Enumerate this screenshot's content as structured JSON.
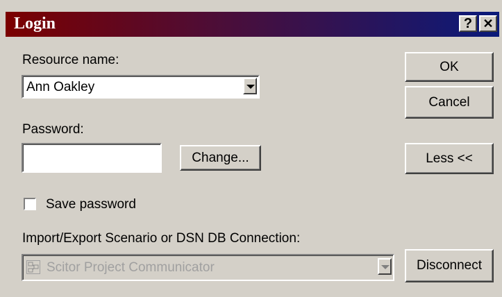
{
  "window": {
    "title": "Login",
    "help_label": "?",
    "close_label": "✕"
  },
  "resource": {
    "label": "Resource name:",
    "value": "Ann Oakley"
  },
  "password": {
    "label": "Password:",
    "value": "",
    "change_label": "Change..."
  },
  "save_password": {
    "label": "Save password",
    "checked": false
  },
  "connection": {
    "label": "Import/Export Scenario or DSN DB Connection:",
    "value": "Scitor Project Communicator",
    "icon": "project-communicator-icon",
    "disabled": true
  },
  "buttons": {
    "ok": "OK",
    "cancel": "Cancel",
    "less": "Less <<",
    "disconnect": "Disconnect"
  }
}
